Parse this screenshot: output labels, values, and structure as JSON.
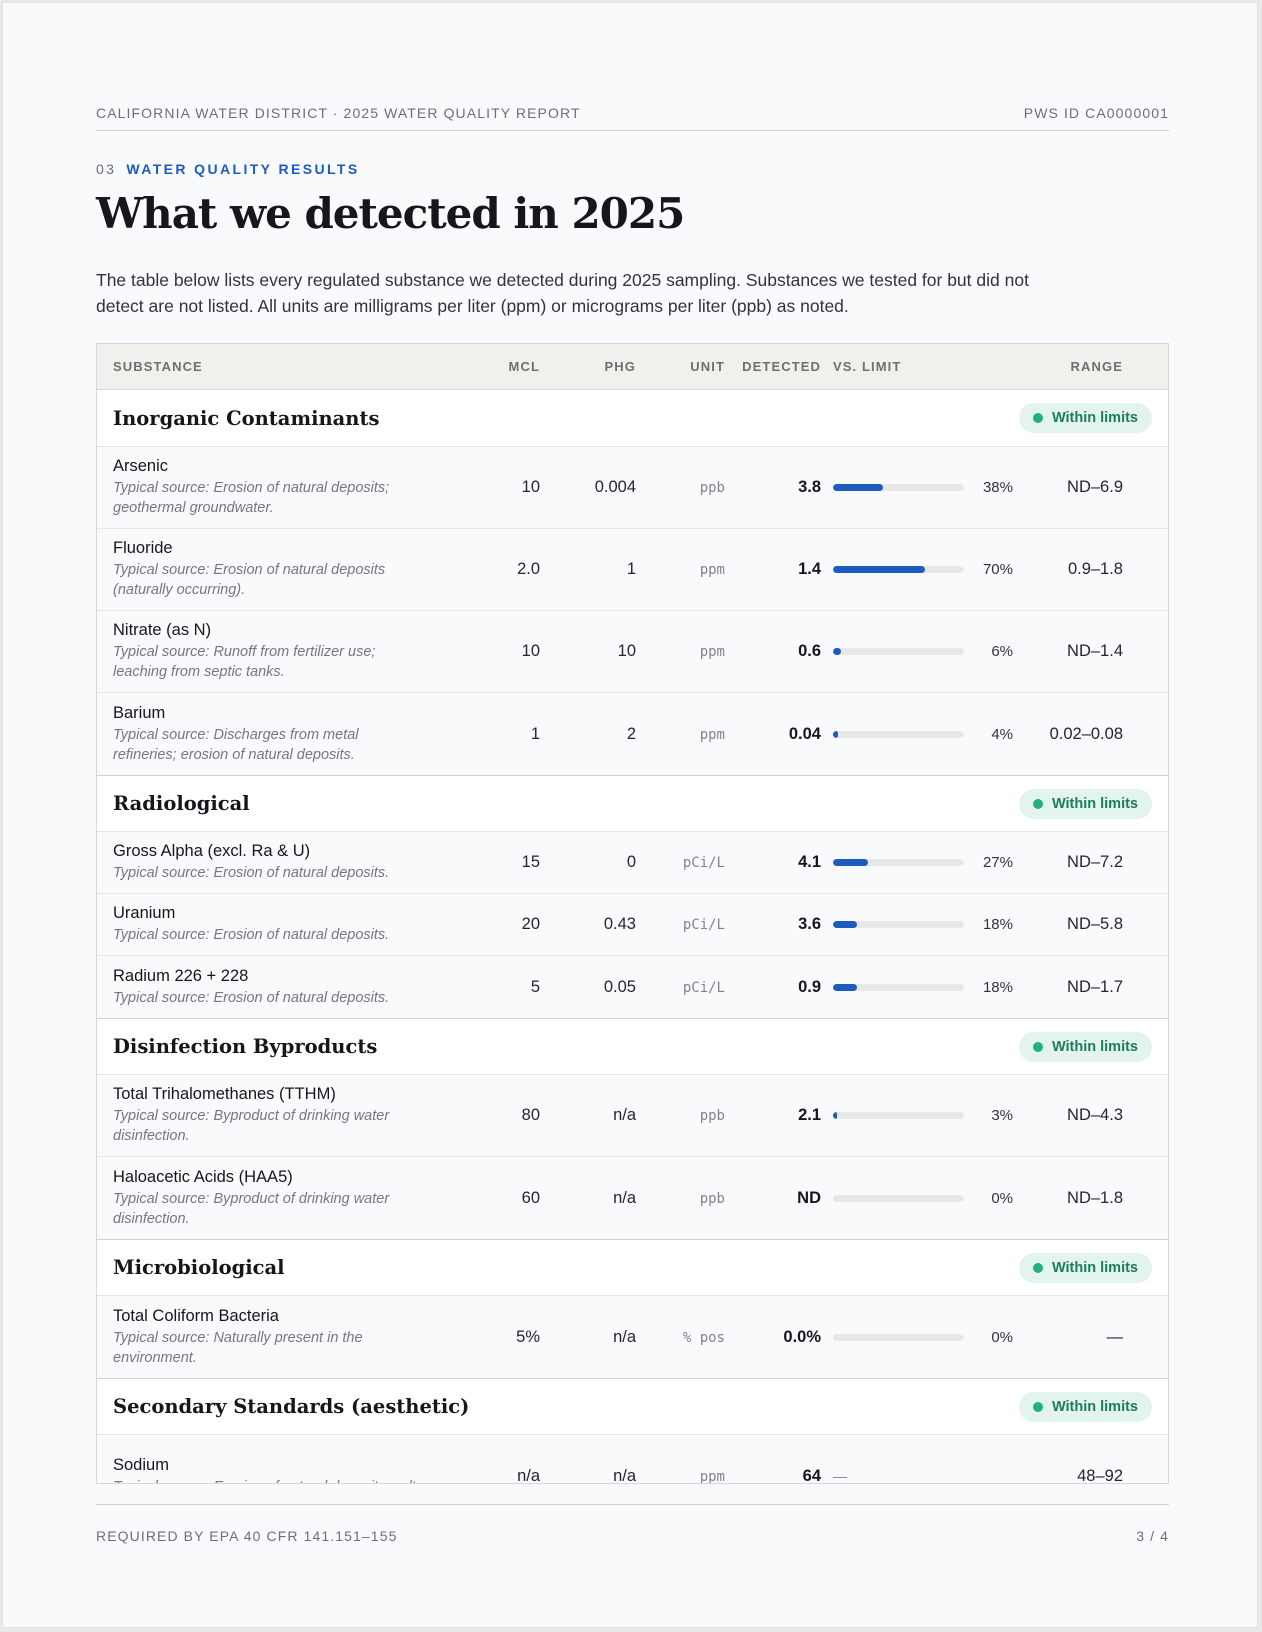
{
  "header": {
    "left": "CALIFORNIA WATER DISTRICT · 2025 WATER QUALITY REPORT",
    "right": "PWS ID CA0000001"
  },
  "section": {
    "number": "03",
    "label": "WATER QUALITY RESULTS",
    "title": "What we detected in 2025",
    "intro": "The table below lists every regulated substance we detected during 2025 sampling. Substances we tested for but did not detect are not listed. All units are milligrams per liter (ppm) or micrograms per liter (ppb) as noted."
  },
  "table": {
    "columns": {
      "substance": "SUBSTANCE",
      "mcl": "MCL",
      "phg": "PHG",
      "unit": "UNIT",
      "detected": "DETECTED",
      "vs_limit": "VS. LIMIT",
      "range": "RANGE"
    },
    "groups": [
      {
        "title": "Inorganic Contaminants",
        "status": "Within limits",
        "rows": [
          {
            "name": "Arsenic",
            "source": "Typical source: Erosion of natural deposits; geothermal groundwater.",
            "mcl": "10",
            "phg": "0.004",
            "unit": "ppb",
            "detected": "3.8",
            "pct": "38%",
            "pct_value": 38,
            "range": "ND–6.9"
          },
          {
            "name": "Fluoride",
            "source": "Typical source: Erosion of natural deposits (naturally occurring).",
            "mcl": "2.0",
            "phg": "1",
            "unit": "ppm",
            "detected": "1.4",
            "pct": "70%",
            "pct_value": 70,
            "range": "0.9–1.8"
          },
          {
            "name": "Nitrate (as N)",
            "source": "Typical source: Runoff from fertilizer use; leaching from septic tanks.",
            "mcl": "10",
            "phg": "10",
            "unit": "ppm",
            "detected": "0.6",
            "pct": "6%",
            "pct_value": 6,
            "range": "ND–1.4"
          },
          {
            "name": "Barium",
            "source": "Typical source: Discharges from metal refineries; erosion of natural deposits.",
            "mcl": "1",
            "phg": "2",
            "unit": "ppm",
            "detected": "0.04",
            "pct": "4%",
            "pct_value": 4,
            "range": "0.02–0.08"
          }
        ]
      },
      {
        "title": "Radiological",
        "status": "Within limits",
        "rows": [
          {
            "name": "Gross Alpha (excl. Ra & U)",
            "source": "Typical source: Erosion of natural deposits.",
            "mcl": "15",
            "phg": "0",
            "unit": "pCi/L",
            "detected": "4.1",
            "pct": "27%",
            "pct_value": 27,
            "range": "ND–7.2"
          },
          {
            "name": "Uranium",
            "source": "Typical source: Erosion of natural deposits.",
            "mcl": "20",
            "phg": "0.43",
            "unit": "pCi/L",
            "detected": "3.6",
            "pct": "18%",
            "pct_value": 18,
            "range": "ND–5.8"
          },
          {
            "name": "Radium 226 + 228",
            "source": "Typical source: Erosion of natural deposits.",
            "mcl": "5",
            "phg": "0.05",
            "unit": "pCi/L",
            "detected": "0.9",
            "pct": "18%",
            "pct_value": 18,
            "range": "ND–1.7"
          }
        ]
      },
      {
        "title": "Disinfection Byproducts",
        "status": "Within limits",
        "rows": [
          {
            "name": "Total Trihalomethanes (TTHM)",
            "source": "Typical source: Byproduct of drinking water disinfection.",
            "mcl": "80",
            "phg": "n/a",
            "unit": "ppb",
            "detected": "2.1",
            "pct": "3%",
            "pct_value": 3,
            "range": "ND–4.3"
          },
          {
            "name": "Haloacetic Acids (HAA5)",
            "source": "Typical source: Byproduct of drinking water disinfection.",
            "mcl": "60",
            "phg": "n/a",
            "unit": "ppb",
            "detected": "ND",
            "pct": "0%",
            "pct_value": 0,
            "range": "ND–1.8"
          }
        ]
      },
      {
        "title": "Microbiological",
        "status": "Within limits",
        "rows": [
          {
            "name": "Total Coliform Bacteria",
            "source": "Typical source: Naturally present in the environment.",
            "mcl": "5%",
            "phg": "n/a",
            "unit": "% pos",
            "detected": "0.0%",
            "pct": "0%",
            "pct_value": 0,
            "range": "—"
          }
        ]
      },
      {
        "title": "Secondary Standards (aesthetic)",
        "status": "Within limits",
        "rows": [
          {
            "name": "Sodium",
            "source": "Typical source: Erosion of natural deposits; salt",
            "mcl": "n/a",
            "phg": "n/a",
            "unit": "ppm",
            "detected": "64",
            "vs_limit_text": "—",
            "pct": "",
            "range": "48–92"
          }
        ]
      }
    ]
  },
  "footer": {
    "left": "REQUIRED BY EPA 40 CFR 141.151–155",
    "right": "3 / 4"
  },
  "colors": {
    "accent": "#1d5bbf",
    "status_green": "#22b07a",
    "badge_bg": "#e3f4ee"
  }
}
